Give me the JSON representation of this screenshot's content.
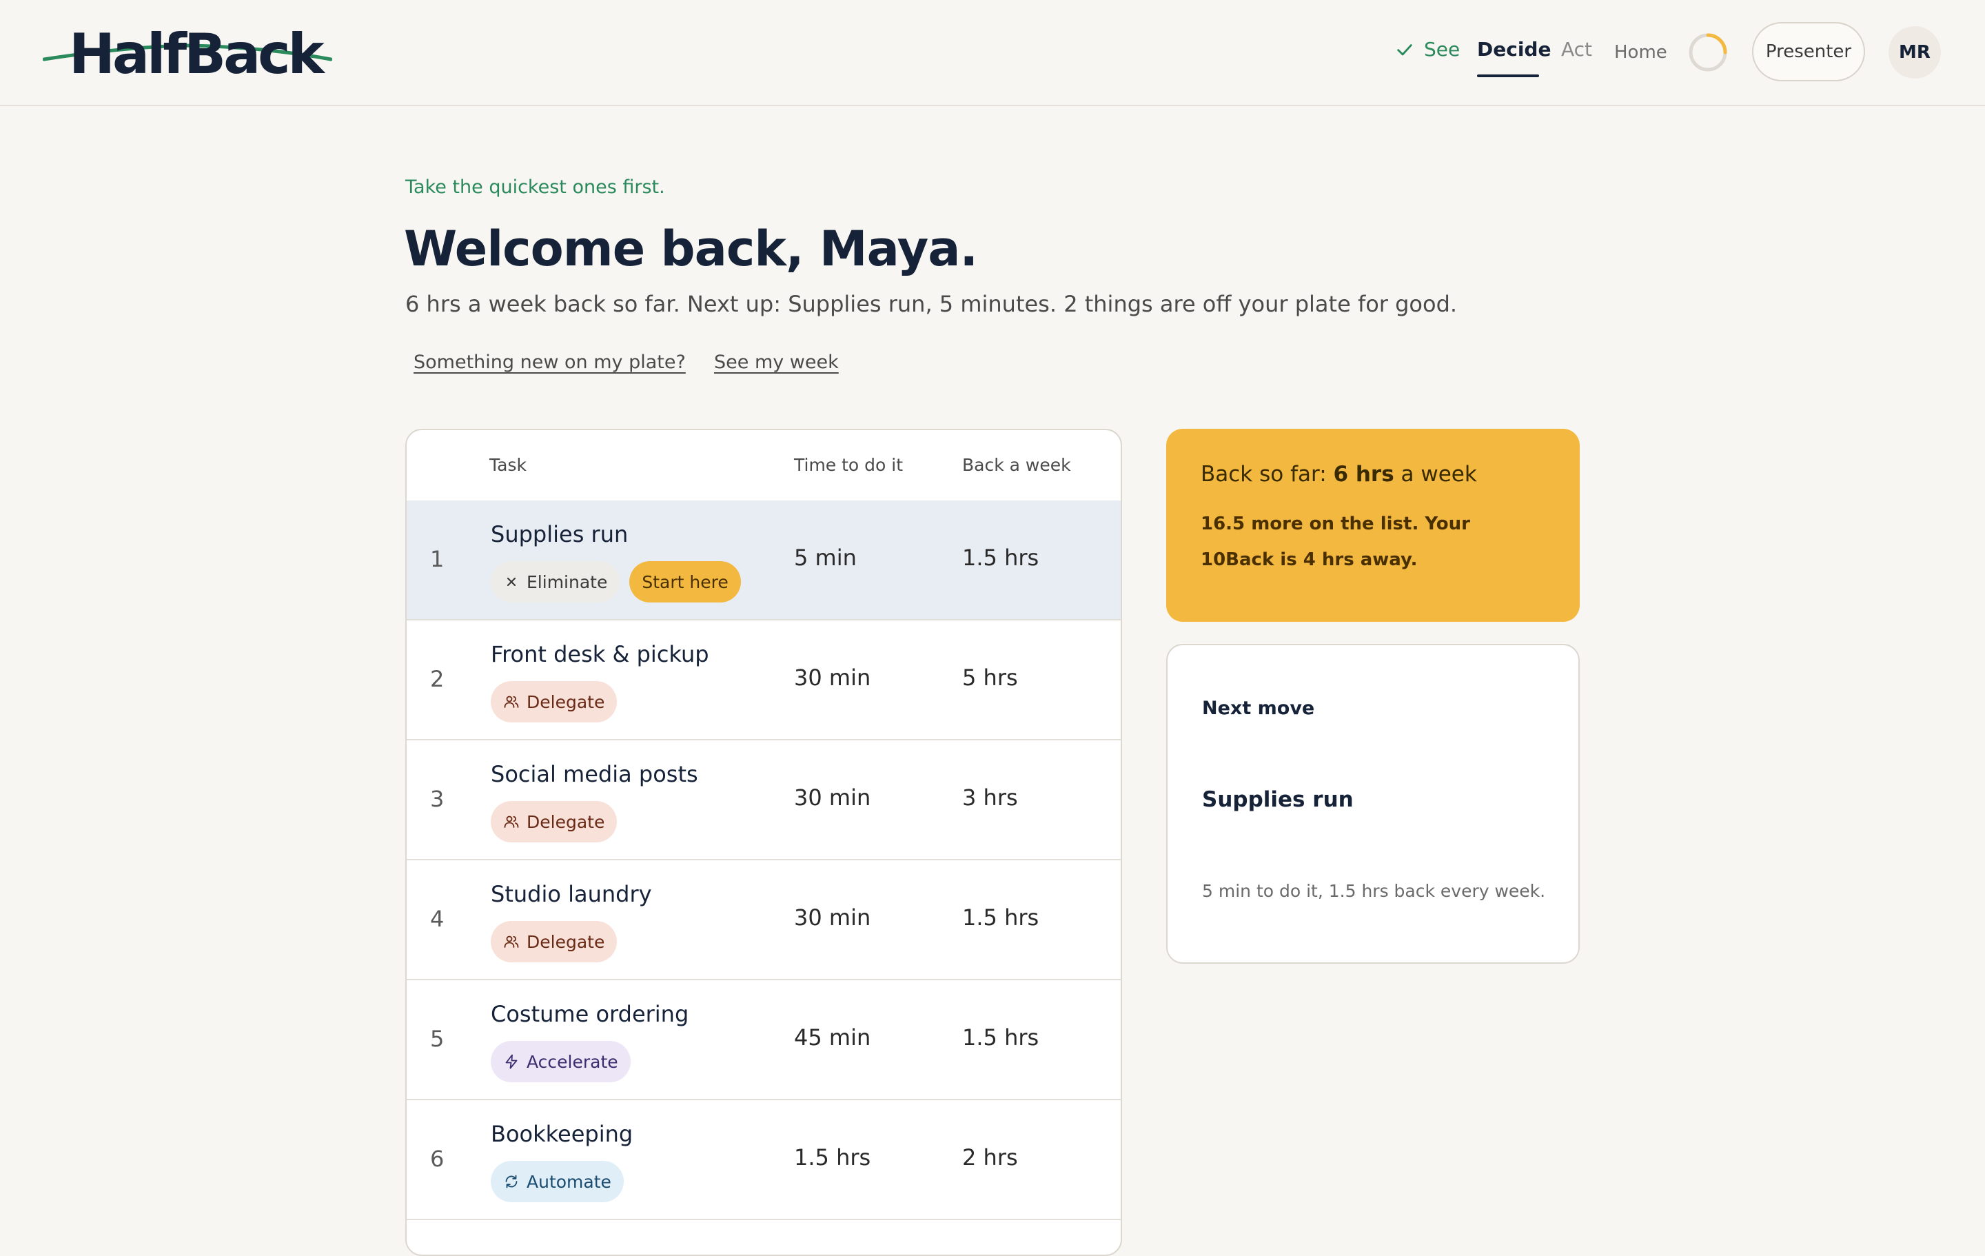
{
  "header": {
    "logo_text": "HalfBack",
    "nav": {
      "see": "See",
      "decide": "Decide",
      "act": "Act",
      "home": "Home"
    },
    "presenter_label": "Presenter",
    "avatar_initials": "MR",
    "progress_fraction": 0.25,
    "accent_color": "#f3b840"
  },
  "intro": {
    "eyebrow": "Take the quickest ones first.",
    "title": "Welcome back, Maya.",
    "subtitle": "6 hrs a week back so far. Next up: Supplies run, 5 minutes. 2 things are off your plate for good.",
    "link_new": "Something new on my plate?",
    "link_week": "See my week"
  },
  "table": {
    "headers": {
      "task": "Task",
      "time": "Time to do it",
      "back": "Back a week"
    },
    "rows": [
      {
        "num": "1",
        "name": "Supplies run",
        "tag": "Eliminate",
        "tag_icon": "x-icon",
        "extra_tag": "Start here",
        "time": "5 min",
        "back": "1.5 hrs"
      },
      {
        "num": "2",
        "name": "Front desk & pickup",
        "tag": "Delegate",
        "tag_icon": "people-icon",
        "time": "30 min",
        "back": "5 hrs"
      },
      {
        "num": "3",
        "name": "Social media posts",
        "tag": "Delegate",
        "tag_icon": "people-icon",
        "time": "30 min",
        "back": "3 hrs"
      },
      {
        "num": "4",
        "name": "Studio laundry",
        "tag": "Delegate",
        "tag_icon": "people-icon",
        "time": "30 min",
        "back": "1.5 hrs"
      },
      {
        "num": "5",
        "name": "Costume ordering",
        "tag": "Accelerate",
        "tag_icon": "lightning-icon",
        "time": "45 min",
        "back": "1.5 hrs"
      },
      {
        "num": "6",
        "name": "Bookkeeping",
        "tag": "Automate",
        "tag_icon": "refresh-icon",
        "time": "1.5 hrs",
        "back": "2 hrs"
      }
    ]
  },
  "summary": {
    "prefix": "Back so far:",
    "value": "6 hrs",
    "suffix": "a week",
    "detail": "16.5 more on the list. Your 10Back is 4 hrs away."
  },
  "next_move": {
    "label": "Next move",
    "task": "Supplies run",
    "meta": "5 min to do it, 1.5 hrs back every week."
  }
}
